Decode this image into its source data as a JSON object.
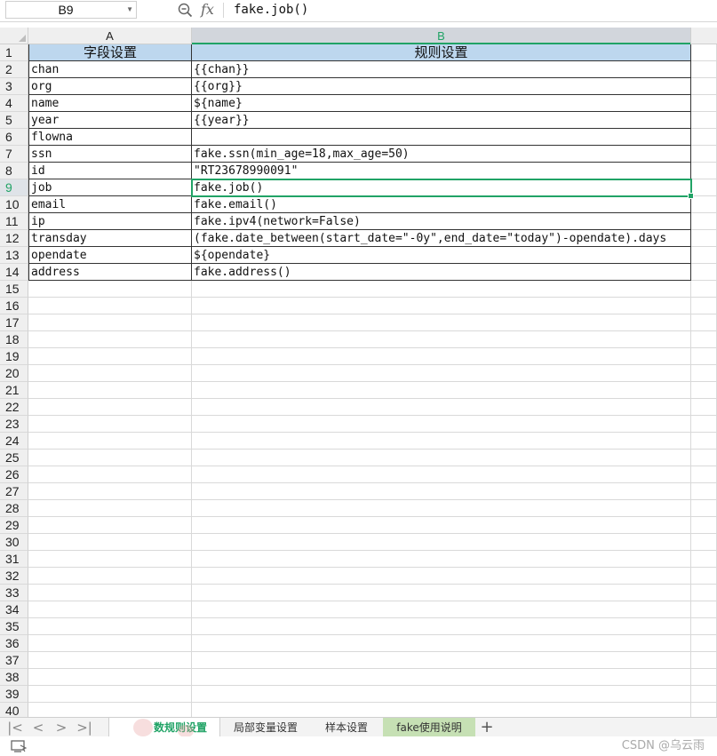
{
  "formula_bar": {
    "name_box": "B9",
    "fx_label": "fx",
    "formula": "fake.job()"
  },
  "columns": {
    "a": "A",
    "b": "B"
  },
  "rows": [
    {
      "num": "1",
      "a": "字段设置",
      "b": "规则设置"
    },
    {
      "num": "2",
      "a": "chan",
      "b": "{{chan}}"
    },
    {
      "num": "3",
      "a": "org",
      "b": "{{org}}"
    },
    {
      "num": "4",
      "a": "name",
      "b": "${name}"
    },
    {
      "num": "5",
      "a": "year",
      "b": "{{year}}"
    },
    {
      "num": "6",
      "a": "flowna",
      "b": ""
    },
    {
      "num": "7",
      "a": "ssn",
      "b": "fake.ssn(min_age=18,max_age=50)"
    },
    {
      "num": "8",
      "a": "id",
      "b": "\"RT23678990091\""
    },
    {
      "num": "9",
      "a": "job",
      "b": "fake.job()"
    },
    {
      "num": "10",
      "a": "email",
      "b": "fake.email()"
    },
    {
      "num": "11",
      "a": "ip",
      "b": "fake.ipv4(network=False)"
    },
    {
      "num": "12",
      "a": "transday",
      "b": "(fake.date_between(start_date=\"-0y\",end_date=\"today\")-opendate).days"
    },
    {
      "num": "13",
      "a": "opendate",
      "b": "${opendate}"
    },
    {
      "num": "14",
      "a": "address",
      "b": "fake.address()"
    },
    {
      "num": "15",
      "a": "",
      "b": ""
    },
    {
      "num": "16",
      "a": "",
      "b": ""
    },
    {
      "num": "17",
      "a": "",
      "b": ""
    },
    {
      "num": "18",
      "a": "",
      "b": ""
    },
    {
      "num": "19",
      "a": "",
      "b": ""
    },
    {
      "num": "20",
      "a": "",
      "b": ""
    },
    {
      "num": "21",
      "a": "",
      "b": ""
    },
    {
      "num": "22",
      "a": "",
      "b": ""
    },
    {
      "num": "23",
      "a": "",
      "b": ""
    },
    {
      "num": "24",
      "a": "",
      "b": ""
    },
    {
      "num": "25",
      "a": "",
      "b": ""
    },
    {
      "num": "26",
      "a": "",
      "b": ""
    },
    {
      "num": "27",
      "a": "",
      "b": ""
    },
    {
      "num": "28",
      "a": "",
      "b": ""
    },
    {
      "num": "29",
      "a": "",
      "b": ""
    },
    {
      "num": "30",
      "a": "",
      "b": ""
    },
    {
      "num": "31",
      "a": "",
      "b": ""
    },
    {
      "num": "32",
      "a": "",
      "b": ""
    },
    {
      "num": "33",
      "a": "",
      "b": ""
    },
    {
      "num": "34",
      "a": "",
      "b": ""
    },
    {
      "num": "35",
      "a": "",
      "b": ""
    },
    {
      "num": "36",
      "a": "",
      "b": ""
    },
    {
      "num": "37",
      "a": "",
      "b": ""
    },
    {
      "num": "38",
      "a": "",
      "b": ""
    },
    {
      "num": "39",
      "a": "",
      "b": ""
    },
    {
      "num": "40",
      "a": "",
      "b": ""
    }
  ],
  "selected_row": "9",
  "sheet_tabs": [
    {
      "label": "数规则设置",
      "active": true
    },
    {
      "label": "局部变量设置",
      "active": false
    },
    {
      "label": "样本设置",
      "active": false
    },
    {
      "label": "fake使用说明",
      "active": false
    }
  ],
  "nav_buttons": [
    "|<",
    "<",
    ">",
    ">|"
  ],
  "add_tab": "+",
  "watermark": "CSDN @乌云雨",
  "colors": {
    "accent": "#21a366",
    "header_fill": "#bdd7ee",
    "tab_green": "#c6e0b4"
  }
}
